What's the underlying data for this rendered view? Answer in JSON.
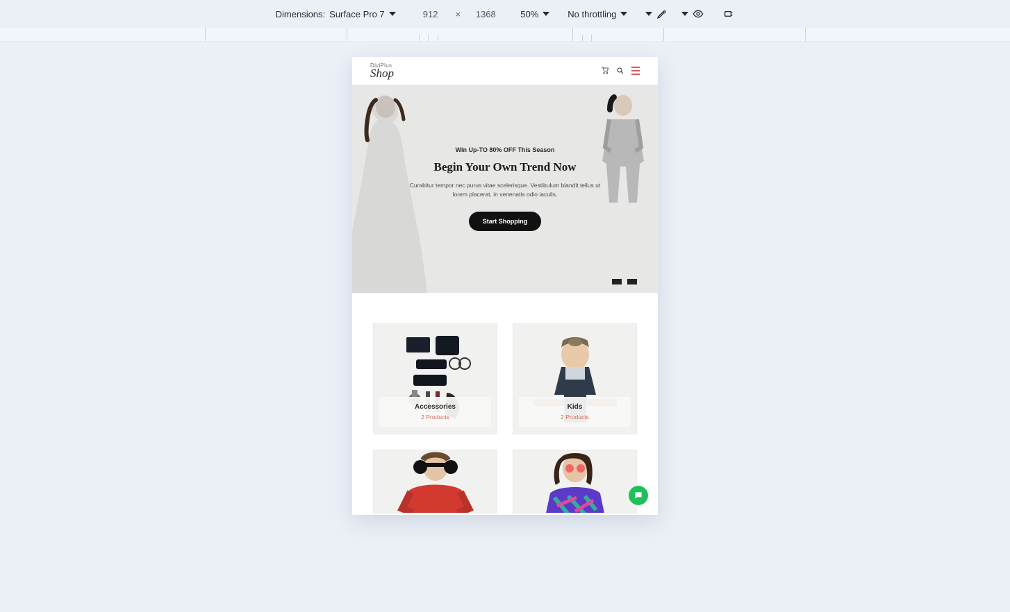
{
  "devtools": {
    "dimensions_label": "Dimensions:",
    "device_name": "Surface Pro 7",
    "width": "912",
    "height": "1368",
    "zoom": "50%",
    "throttling": "No throttling"
  },
  "site": {
    "logo_top": "DiviPlus",
    "logo_main": "Shop",
    "hero": {
      "eyebrow": "Win Up-TO 80% OFF This Season",
      "title": "Begin Your Own Trend Now",
      "body": "Curabitur tempor nec purus vitae scelerisque. Vestibulum blandit tellus ut lorem placerat, in venenatis odio iaculis.",
      "cta": "Start Shopping"
    },
    "categories": [
      {
        "title": "Accessories",
        "count": "2 Products"
      },
      {
        "title": "Kids",
        "count": "2 Products"
      }
    ]
  }
}
